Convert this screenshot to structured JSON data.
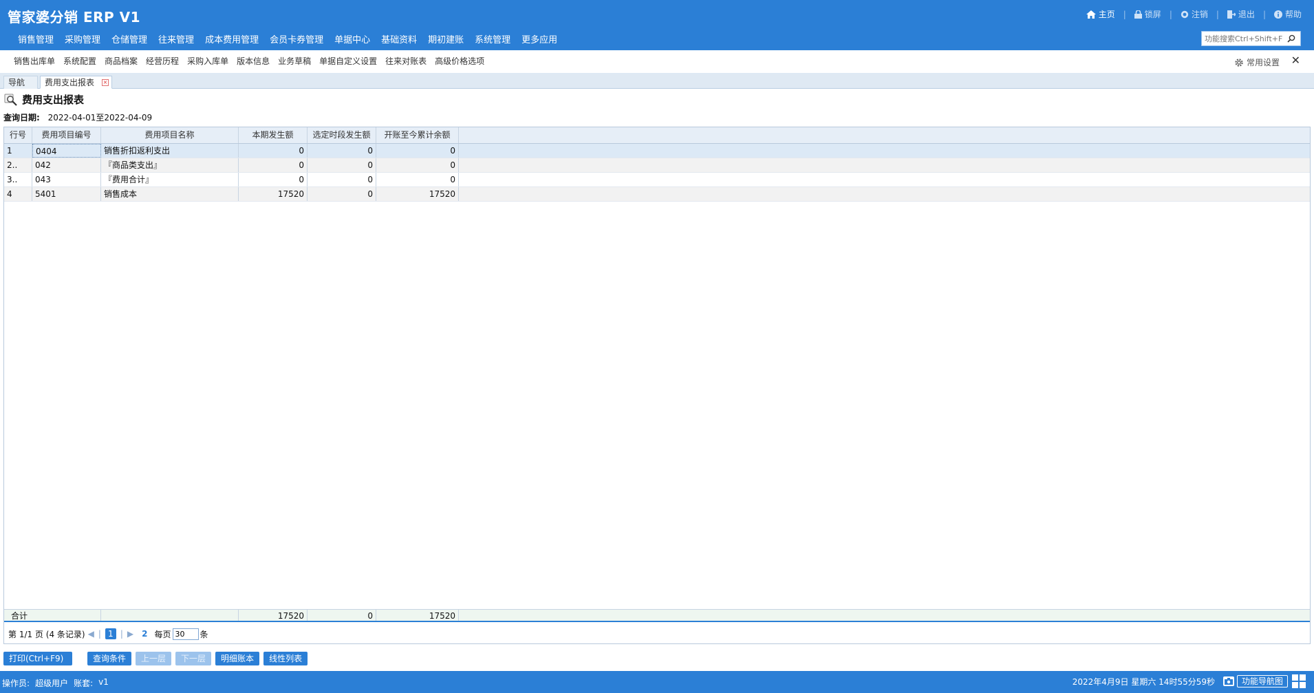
{
  "app": {
    "title": "管家婆分销 ERP V1"
  },
  "top_links": {
    "home": "主页",
    "lock": "锁屏",
    "logout_user": "注销",
    "exit": "退出",
    "help": "帮助"
  },
  "main_nav": [
    "销售管理",
    "采购管理",
    "仓储管理",
    "往来管理",
    "成本费用管理",
    "会员卡券管理",
    "单据中心",
    "基础资料",
    "期初建账",
    "系统管理",
    "更多应用"
  ],
  "func_search": {
    "placeholder": "功能搜索Ctrl+Shift+F"
  },
  "quick_items": [
    "销售出库单",
    "系统配置",
    "商品档案",
    "经营历程",
    "采购入库单",
    "版本信息",
    "业务草稿",
    "单据自定义设置",
    "往来对账表",
    "高级价格选项"
  ],
  "quick_settings": "常用设置",
  "tabs": {
    "nav": "导航",
    "report": "费用支出报表"
  },
  "report": {
    "title": "费用支出报表",
    "query_label": "查询日期:",
    "query_range": "2022-04-01至2022-04-09"
  },
  "grid": {
    "columns": [
      "行号",
      "费用项目编号",
      "费用项目名称",
      "本期发生额",
      "选定时段发生额",
      "开账至今累计余额"
    ],
    "rows": [
      [
        "1",
        "0404",
        "销售折扣返利支出",
        "0",
        "0",
        "0"
      ],
      [
        "2..",
        "042",
        "『商品类支出』",
        "0",
        "0",
        "0"
      ],
      [
        "3..",
        "043",
        "『费用合计』",
        "0",
        "0",
        "0"
      ],
      [
        "4",
        "5401",
        "销售成本",
        "17520",
        "0",
        "17520"
      ]
    ],
    "total": {
      "label": "合计",
      "current": "17520",
      "selected": "0",
      "cumulative": "17520"
    }
  },
  "pager": {
    "page_info": "第  1/1 页  (4 条记录)",
    "current_page": "1",
    "refresh": "2",
    "per_page_label": "每页",
    "per_page_value": "30",
    "per_page_unit": "条"
  },
  "buttons": {
    "print": "打印(Ctrl+F9)",
    "query": "查询条件",
    "up": "上一层",
    "down": "下一层",
    "detail": "明细账本",
    "line": "线性列表"
  },
  "status": {
    "operator_label": "操作员:",
    "operator": "超级用户",
    "account_label": "账套:",
    "account": "v1",
    "datetime": "2022年4月9日  星期六  14时55分59秒",
    "nav_map": "功能导航图"
  },
  "colors": {
    "brand_blue": "#2b7fd6",
    "selected_row": "#dce9f6"
  }
}
